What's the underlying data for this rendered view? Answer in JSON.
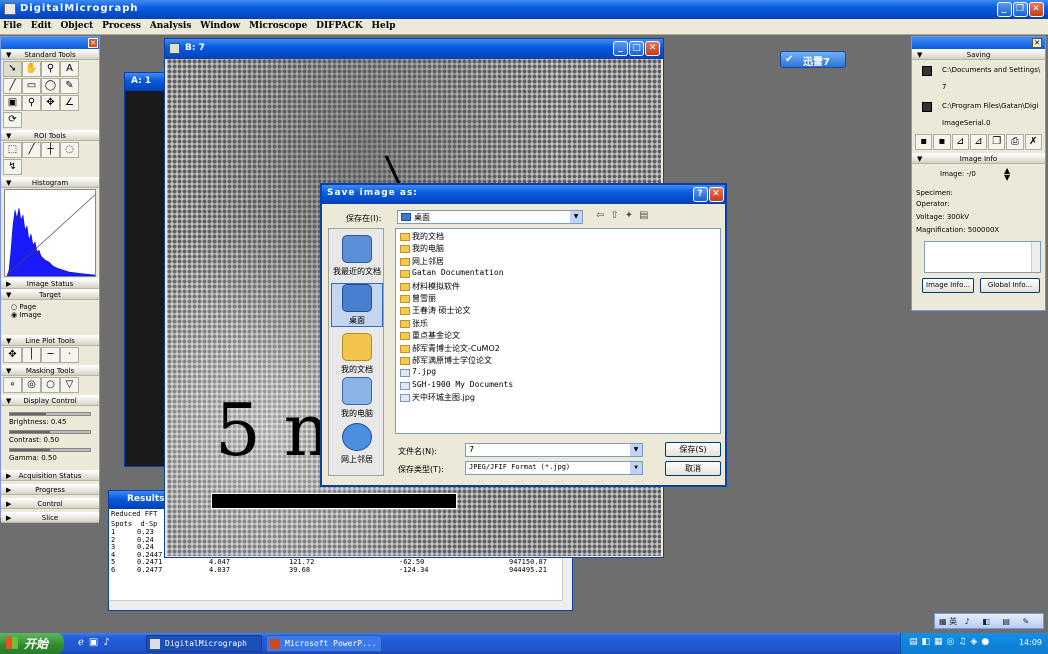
{
  "app": {
    "title": "DigitalMicrograph",
    "menu": [
      "File",
      "Edit",
      "Object",
      "Process",
      "Analysis",
      "Window",
      "Microscope",
      "DIFPACK",
      "Help"
    ]
  },
  "tools_palette": {
    "sections": {
      "standard": "Standard Tools",
      "roi": "ROI Tools",
      "histogram": "Histogram",
      "image_status": "Image Status",
      "target": "Target",
      "line_plot": "Line Plot Tools",
      "masking": "Masking Tools",
      "display_control": "Display Control",
      "acquisition_status": "Acquisition Status",
      "progress": "Progress",
      "control": "Control",
      "slice": "Slice"
    },
    "target": {
      "page": "Page",
      "image": "Image"
    },
    "display": {
      "brightness": "Brightness: 0.45",
      "contrast": "Contrast: 0.50",
      "gamma": "Gamma: 0.50"
    },
    "display_levels": {
      "brightness": 0.45,
      "contrast": 0.5,
      "gamma": 0.5
    }
  },
  "windows": {
    "a": {
      "title": "A: 1"
    },
    "b": {
      "title": "B: 7",
      "scale_label": "5 n"
    },
    "results": {
      "title": "Results",
      "subtitle": "Reduced FFT",
      "headers": [
        "Spots",
        "d-Sp"
      ],
      "rows": [
        [
          "1",
          "0.23",
          "",
          "",
          "",
          ""
        ],
        [
          "2",
          "0.24",
          "",
          "",
          "",
          ""
        ],
        [
          "3",
          "0.24",
          "",
          "",
          "",
          ""
        ],
        [
          "4",
          "0.2447",
          "4.087",
          "175.77",
          "-3.95",
          "952440.65"
        ],
        [
          "5",
          "0.2471",
          "4.047",
          "121.72",
          "-62.50",
          "947150.87"
        ],
        [
          "6",
          "0.2477",
          "4.037",
          "39.68",
          "-124.34",
          "944495.21"
        ]
      ]
    }
  },
  "floating_badge": "迅雷7",
  "dialog": {
    "title": "Save image as:",
    "save_in_label": "保存在(I):",
    "save_in_value": "桌面",
    "places": [
      "我最近的文档",
      "桌面",
      "我的文档",
      "我的电脑",
      "网上邻居"
    ],
    "files": [
      {
        "name": "我的文档",
        "kind": "folder"
      },
      {
        "name": "我的电脑",
        "kind": "folder"
      },
      {
        "name": "网上邻居",
        "kind": "folder"
      },
      {
        "name": "Gatan Documentation",
        "kind": "folder"
      },
      {
        "name": "材料模拟软件",
        "kind": "folder"
      },
      {
        "name": "曾雪丽",
        "kind": "folder"
      },
      {
        "name": "王春涛 硕士论文",
        "kind": "folder"
      },
      {
        "name": "张乐",
        "kind": "folder"
      },
      {
        "name": "重点基金论文",
        "kind": "folder"
      },
      {
        "name": "郝军青博士论文-CuMO2",
        "kind": "folder"
      },
      {
        "name": "郝军满原博士学位论文",
        "kind": "folder"
      },
      {
        "name": "7.jpg",
        "kind": "file"
      },
      {
        "name": "SGH-i900 My Documents",
        "kind": "file"
      },
      {
        "name": "天中环城主图.jpg",
        "kind": "file"
      }
    ],
    "filename_label": "文件名(N):",
    "filename_value": "7",
    "filetype_label": "保存类型(T):",
    "filetype_value": "JPEG/JFIF Format (*.jpg)",
    "save_button": "保存(S)",
    "cancel_button": "取消"
  },
  "right_panel": {
    "saving_title": "Saving",
    "paths": [
      "C:\\Documents and Settings\\",
      "7",
      "C:\\Program Files\\Gatan\\Digi",
      "ImageSerial.0"
    ],
    "image_info_title": "Image Info",
    "image_label": "Image: -/0",
    "specimen": "Specimen:",
    "operator": "Operator:",
    "voltage": "Voltage: 300kV",
    "magnification": "Magnification: 500000X",
    "image_info_button": "Image Info...",
    "global_info_button": "Global Info..."
  },
  "taskbar": {
    "start": "开始",
    "tasks": [
      "DigitalMicrograph",
      "Microsoft PowerP..."
    ],
    "clock": "14:09",
    "tray_text": "英"
  },
  "colors": {
    "xp_blue": "#0a5ce0",
    "window_bg": "#ece9d8",
    "desktop": "#6e6e6e",
    "histogram": "#1a1aff"
  }
}
